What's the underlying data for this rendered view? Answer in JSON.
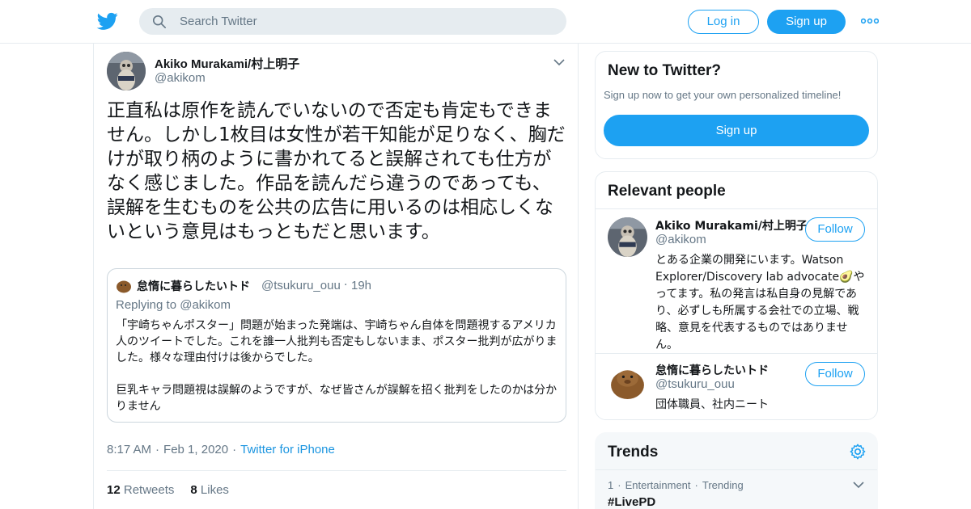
{
  "colors": {
    "brand": "#1da1f2",
    "text": "#14171a",
    "secondary": "#657786",
    "border": "#e6ecf0"
  },
  "header": {
    "logo_icon": "twitter-bird-icon",
    "search_placeholder": "Search Twitter",
    "login_label": "Log in",
    "signup_label": "Sign up",
    "more_icon": "more-dots-icon"
  },
  "tweet": {
    "author_name": "Akiko Murakami/村上明子",
    "author_handle": "@akikom",
    "text": "正直私は原作を読んでいないので否定も肯定もできません。しかし1枚目は女性が若干知能が足りなく、胸だけが取り柄のように書かれてると誤解されても仕方がなく感じました。作品を読んだら違うのであっても、誤解を生むものを公共の広告に用いるのは相応しくないという意見はもっともだと思います。",
    "quote": {
      "author_name": "怠惰に暮らしたいトド",
      "author_handle": "@tsukuru_ouu",
      "separator": "·",
      "time": "19h",
      "replying_prefix": "Replying to",
      "replying_handle": "@akikom",
      "paragraph1": "「宇崎ちゃんポスター」問題が始まった発端は、宇崎ちゃん自体を問題視するアメリカ人のツイートでした。これを誰一人批判も否定もしないまま、ポスター批判が広がりました。様々な理由付けは後からでした。",
      "paragraph2": "巨乳キャラ問題視は誤解のようですが、なぜ皆さんが誤解を招く批判をしたのかは分かりません"
    },
    "time": "8:17 AM",
    "date": "Feb 1, 2020",
    "source": "Twitter for iPhone",
    "separator": "·",
    "retweets_count": "12",
    "retweets_label": "Retweets",
    "likes_count": "8",
    "likes_label": "Likes"
  },
  "sidebar": {
    "new": {
      "title": "New to Twitter?",
      "subtitle": "Sign up now to get your own personalized timeline!",
      "signup_label": "Sign up"
    },
    "relevant": {
      "title": "Relevant people",
      "people": [
        {
          "name": "Akiko Murakami/村上明子",
          "handle": "@akikom",
          "bio": "とある企業の開発にいます。Watson Explorer/Discovery lab advocate🥑やってます。私の発言は私自身の見解であり、必ずしも所属する会社での立場、戦略、意見を代表するものではありません。",
          "follow_label": "Follow"
        },
        {
          "name": "怠惰に暮らしたいトド",
          "handle": "@tsukuru_ouu",
          "bio": "団体職員、社内ニート",
          "follow_label": "Follow"
        }
      ]
    },
    "trends": {
      "title": "Trends",
      "settings_icon": "gear-icon",
      "items": [
        {
          "rank": "1",
          "category": "Entertainment",
          "status": "Trending",
          "separator": "·",
          "name": "#LivePD"
        }
      ]
    }
  }
}
